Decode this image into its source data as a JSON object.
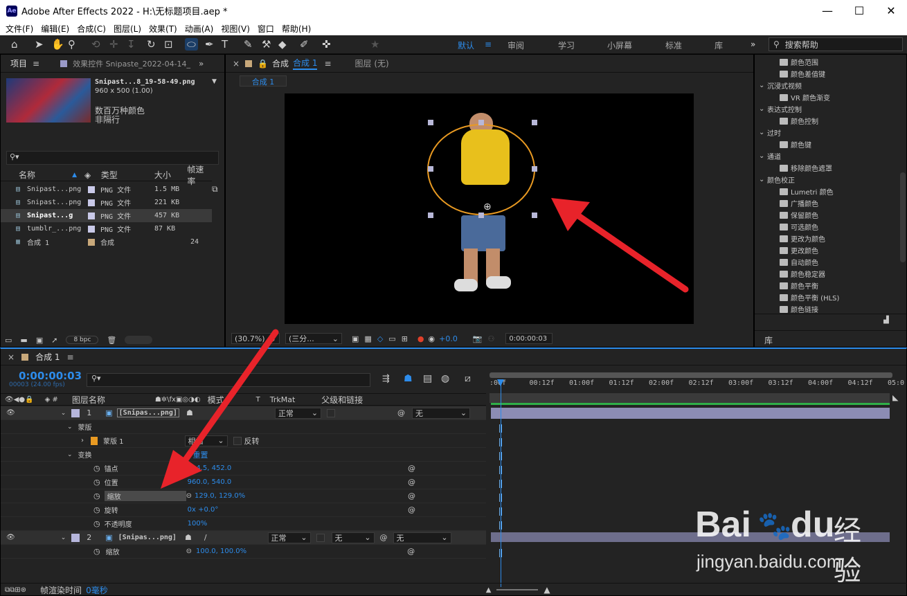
{
  "window": {
    "title": "Adobe After Effects 2022 - H:\\无标题项目.aep *",
    "logo": "Ae",
    "minimize": "—",
    "maximize": "☐",
    "close": "✕"
  },
  "menu": [
    "文件(F)",
    "编辑(E)",
    "合成(C)",
    "图层(L)",
    "效果(T)",
    "动画(A)",
    "视图(V)",
    "窗口",
    "帮助(H)"
  ],
  "workspaces": {
    "default": "默认",
    "review": "审阅",
    "learn": "学习",
    "small": "小屏幕",
    "standard": "标准",
    "library": "库",
    "more": "»",
    "search_placeholder": "搜索帮助"
  },
  "project": {
    "tab": "项目",
    "effects_tab": "效果控件 Snipaste_2022-04-14_",
    "item_name": "Snipast...8_19-58-49.png",
    "item_size": "960 x 500 (1.00)",
    "item_color": "数百万种颜色",
    "item_interlace": "非隔行",
    "search_placeholder": "",
    "columns": [
      "名称",
      "类型",
      "大小",
      "帧速率"
    ],
    "items": [
      {
        "name": "Snipast...png",
        "type": "PNG 文件",
        "size": "1.5 MB",
        "fps": "",
        "chip": "#c9c9e8"
      },
      {
        "name": "Snipast...png",
        "type": "PNG 文件",
        "size": "221 KB",
        "fps": "",
        "chip": "#c9c9e8"
      },
      {
        "name": "Snipast...g",
        "type": "PNG 文件",
        "size": "457 KB",
        "fps": "",
        "chip": "#c9c9e8"
      },
      {
        "name": "tumblr_...png",
        "type": "PNG 文件",
        "size": "87 KB",
        "fps": "",
        "chip": "#c9c9e8"
      },
      {
        "name": "合成 1",
        "type": "合成",
        "size": "",
        "fps": "24",
        "chip": "#c8a87a"
      }
    ],
    "bpc": "8 bpc"
  },
  "comp": {
    "tab": "合成",
    "tab_name": "合成 1",
    "layer_tab": "图层 (无)",
    "sub_tab": "合成 1",
    "zoom": "(30.7%)",
    "res": "(三分...",
    "exposure": "+0.0",
    "timecode": "0:00:00:03"
  },
  "effects": {
    "items": [
      {
        "kind": "fx",
        "label": "颜色范围",
        "indent": 2
      },
      {
        "kind": "fx",
        "label": "颜色差值键",
        "indent": 2
      },
      {
        "kind": "cat",
        "label": "沉浸式视频",
        "indent": 1
      },
      {
        "kind": "fx",
        "label": "VR 颜色渐变",
        "indent": 2
      },
      {
        "kind": "cat",
        "label": "表达式控制",
        "indent": 1
      },
      {
        "kind": "fx",
        "label": "颜色控制",
        "indent": 2
      },
      {
        "kind": "cat",
        "label": "过时",
        "indent": 1
      },
      {
        "kind": "fx",
        "label": "颜色键",
        "indent": 2
      },
      {
        "kind": "cat",
        "label": "通道",
        "indent": 1
      },
      {
        "kind": "fx",
        "label": "移除颜色遮罩",
        "indent": 2
      },
      {
        "kind": "cat",
        "label": "颜色校正",
        "indent": 1
      },
      {
        "kind": "fx",
        "label": "Lumetri 颜色",
        "indent": 2
      },
      {
        "kind": "fx",
        "label": "广播颜色",
        "indent": 2
      },
      {
        "kind": "fx",
        "label": "保留颜色",
        "indent": 2
      },
      {
        "kind": "fx",
        "label": "可选颜色",
        "indent": 2
      },
      {
        "kind": "fx",
        "label": "更改为颜色",
        "indent": 2
      },
      {
        "kind": "fx",
        "label": "更改颜色",
        "indent": 2
      },
      {
        "kind": "fx",
        "label": "自动颜色",
        "indent": 2
      },
      {
        "kind": "fx",
        "label": "颜色稳定器",
        "indent": 2
      },
      {
        "kind": "fx",
        "label": "颜色平衡",
        "indent": 2
      },
      {
        "kind": "fx",
        "label": "颜色平衡 (HLS)",
        "indent": 2
      },
      {
        "kind": "fx",
        "label": "颜色链接",
        "indent": 2
      }
    ],
    "library_tab": "库"
  },
  "timeline": {
    "tab": "合成 1",
    "timecode": "0:00:00:03",
    "frame_info": "00003 (24.00 fps)",
    "columns": {
      "layer_name": "图层名称",
      "mode": "模式",
      "t": "T",
      "trkmat": "TrkMat",
      "parent": "父级和链接"
    },
    "ticks": [
      ":00f",
      "00:12f",
      "01:00f",
      "01:12f",
      "02:00f",
      "02:12f",
      "03:00f",
      "03:12f",
      "04:00f",
      "04:12f",
      "05:0"
    ],
    "layer1": {
      "num": "1",
      "name": "[Snipas...png]",
      "mode": "正常",
      "parent": "无"
    },
    "mask_group": "蒙版",
    "mask1": "蒙版 1",
    "mask_mode": "相加",
    "mask_invert": "反转",
    "transform": "变换",
    "reset": "重置",
    "props": [
      {
        "name": "锚点",
        "value": "214.5, 452.0"
      },
      {
        "name": "位置",
        "value": "960.0, 540.0"
      },
      {
        "name": "缩放",
        "value": "129.0, 129.0%"
      },
      {
        "name": "旋转",
        "value": "0x +0.0°"
      },
      {
        "name": "不透明度",
        "value": "100%"
      }
    ],
    "layer2": {
      "num": "2",
      "name": "[Snipas...png]",
      "mode": "正常",
      "trkmat": "无",
      "parent": "无"
    },
    "layer2_prop": {
      "name": "缩放",
      "value": "100.0, 100.0%"
    },
    "render_label": "帧渲染时间",
    "render_value": "0毫秒"
  },
  "watermark": {
    "brand": "Bai",
    "brand2": "du",
    "cn": "经验",
    "url": "jingyan.baidu.com"
  },
  "colors": {
    "accent": "#2d8ceb",
    "arrow": "#e8232a",
    "mask": "#e99a22",
    "layer_chip": "#b6b6dc"
  }
}
